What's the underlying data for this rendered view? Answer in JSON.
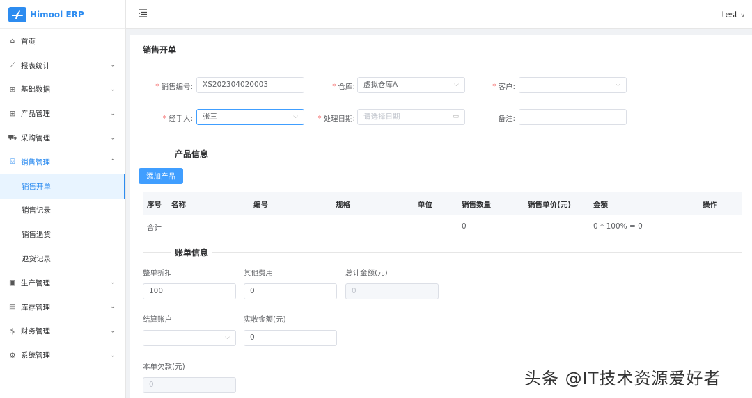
{
  "brand": {
    "name": "Himool ERP"
  },
  "header": {
    "user": "test",
    "user_arrow": "∨"
  },
  "sidebar": {
    "items": [
      {
        "label": "首页",
        "icon": "home-icon",
        "glyph": "⌂",
        "arrow": ""
      },
      {
        "label": "报表统计",
        "icon": "chart-icon",
        "glyph": "⟋",
        "arrow": "⌄"
      },
      {
        "label": "基础数据",
        "icon": "grid-icon",
        "glyph": "⊞",
        "arrow": "⌄"
      },
      {
        "label": "产品管理",
        "icon": "apps-icon",
        "glyph": "⊞",
        "arrow": "⌄"
      },
      {
        "label": "采购管理",
        "icon": "cart-icon",
        "glyph": "⛟",
        "arrow": "⌄"
      },
      {
        "label": "销售管理",
        "icon": "bag-icon",
        "glyph": "⍌",
        "arrow": "⌃"
      }
    ],
    "sub_items": [
      {
        "label": "销售开单",
        "active": true
      },
      {
        "label": "销售记录",
        "active": false
      },
      {
        "label": "销售退货",
        "active": false
      },
      {
        "label": "退货记录",
        "active": false
      }
    ],
    "items2": [
      {
        "label": "生产管理",
        "icon": "factory-icon",
        "glyph": "▣",
        "arrow": "⌄"
      },
      {
        "label": "库存管理",
        "icon": "inventory-icon",
        "glyph": "▤",
        "arrow": "⌄"
      },
      {
        "label": "财务管理",
        "icon": "dollar-icon",
        "glyph": "$",
        "arrow": "⌄"
      },
      {
        "label": "系统管理",
        "icon": "settings-icon",
        "glyph": "⚙",
        "arrow": "⌄"
      }
    ]
  },
  "page": {
    "title": "销售开单"
  },
  "form": {
    "sale_no": {
      "label": "销售编号",
      "value": "XS202304020003"
    },
    "warehouse": {
      "label": "仓库",
      "value": "虚拟仓库A"
    },
    "customer": {
      "label": "客户",
      "value": ""
    },
    "handler": {
      "label": "经手人",
      "value": "张三"
    },
    "date": {
      "label": "处理日期",
      "placeholder": "请选择日期"
    },
    "remark": {
      "label": "备注",
      "value": ""
    },
    "colon": ":"
  },
  "product_section": {
    "title": "产品信息",
    "add_button": "添加产品",
    "columns": [
      "序号",
      "名称",
      "编号",
      "规格",
      "单位",
      "销售数量",
      "销售单价(元)",
      "金额",
      "操作"
    ],
    "total_row": {
      "label": "合计",
      "quantity": "0",
      "amount": "0 * 100% = 0"
    }
  },
  "bill_section": {
    "title": "账单信息",
    "discount": {
      "label": "整单折扣",
      "value": "100"
    },
    "other_fee": {
      "label": "其他费用",
      "value": "0"
    },
    "total_amount": {
      "label": "总计金额(元)",
      "value": "0"
    },
    "account": {
      "label": "结算账户",
      "value": ""
    },
    "received": {
      "label": "实收金额(元)",
      "value": "0"
    },
    "arrears": {
      "label": "本单欠款(元)",
      "value": "0"
    }
  },
  "watermark": "头条 @IT技术资源爱好者",
  "colors": {
    "accent": "#409eff",
    "brand": "#2d8cf0",
    "required": "#f56c6c"
  }
}
